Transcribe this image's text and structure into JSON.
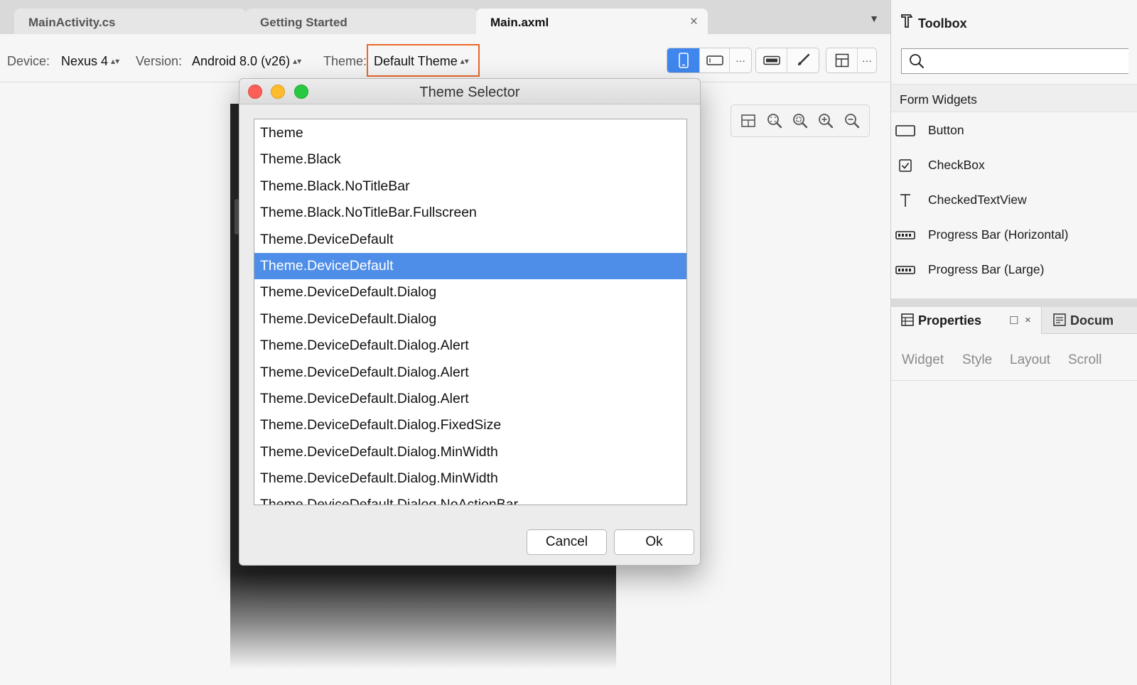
{
  "tabs": [
    {
      "label": "MainActivity.cs",
      "active": false
    },
    {
      "label": "Getting Started",
      "active": false
    },
    {
      "label": "Main.axml",
      "active": true
    }
  ],
  "tab_close_glyph": "×",
  "toolbar": {
    "device_label": "Device:",
    "device_value": "Nexus 4",
    "version_label": "Version:",
    "version_value": "Android 8.0 (v26)",
    "theme_label": "Theme:",
    "theme_value": "Default Theme",
    "more_glyph": "···"
  },
  "dialog": {
    "title": "Theme Selector",
    "items": [
      "Theme",
      "Theme.Black",
      "Theme.Black.NoTitleBar",
      "Theme.Black.NoTitleBar.Fullscreen",
      "Theme.DeviceDefault",
      "Theme.DeviceDefault",
      "Theme.DeviceDefault.Dialog",
      "Theme.DeviceDefault.Dialog",
      "Theme.DeviceDefault.Dialog.Alert",
      "Theme.DeviceDefault.Dialog.Alert",
      "Theme.DeviceDefault.Dialog.Alert",
      "Theme.DeviceDefault.Dialog.FixedSize",
      "Theme.DeviceDefault.Dialog.MinWidth",
      "Theme.DeviceDefault.Dialog.MinWidth",
      "Theme.DeviceDefault.Dialog.NoActionBar"
    ],
    "selected_index": 5,
    "cancel_label": "Cancel",
    "ok_label": "Ok"
  },
  "toolbox": {
    "title": "Toolbox",
    "search_value": "",
    "section_title": "Form Widgets",
    "widgets": [
      {
        "label": "Button",
        "icon": "button-widget-icon"
      },
      {
        "label": "CheckBox",
        "icon": "checkbox-widget-icon"
      },
      {
        "label": "CheckedTextView",
        "icon": "text-widget-icon"
      },
      {
        "label": "Progress Bar (Horizontal)",
        "icon": "progress-bar-icon"
      },
      {
        "label": "Progress Bar (Large)",
        "icon": "progress-bar-icon"
      }
    ]
  },
  "properties": {
    "title": "Properties",
    "document_tab": "Docum",
    "subtabs": [
      "Widget",
      "Style",
      "Layout",
      "Scroll"
    ]
  },
  "colors": {
    "accent": "#3f87ee",
    "selection": "#4f8ee8",
    "highlight_border": "#e8682a",
    "close_light": "#fc5f57",
    "minimize_light": "#fdbc2e",
    "zoom_light": "#28c840"
  }
}
